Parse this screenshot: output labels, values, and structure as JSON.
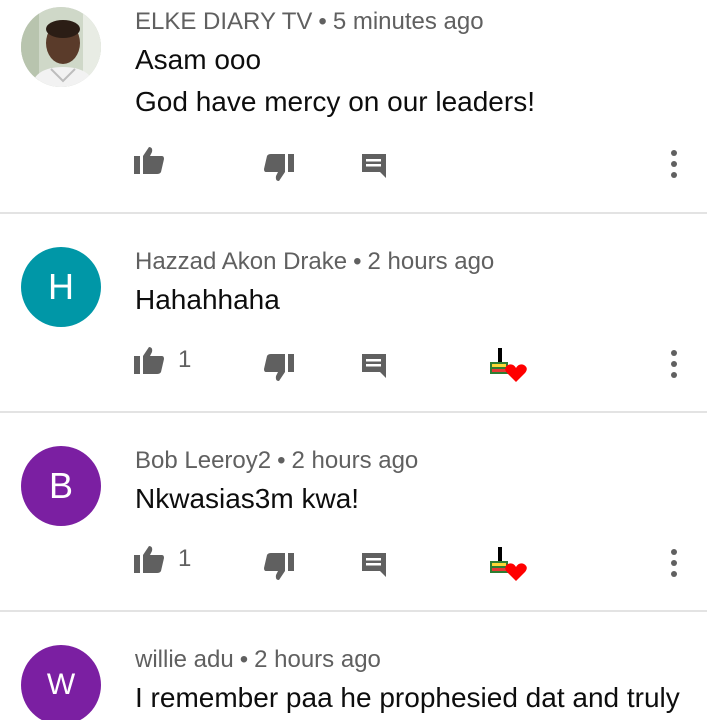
{
  "comments": [
    {
      "author": "ELKE DIARY TV",
      "time": "5 minutes ago",
      "avatar": {
        "type": "photo",
        "icon": "user-photo-avatar"
      },
      "lines": [
        "Asam ooo",
        "God have mercy on our leaders!"
      ],
      "likes": "",
      "creator_heart": false
    },
    {
      "author": "Hazzad Akon Drake",
      "time": "2 hours ago",
      "avatar": {
        "type": "letter",
        "letter": "H",
        "color": "#0097a7"
      },
      "lines": [
        "Hahahhaha"
      ],
      "likes": "1",
      "creator_heart": true
    },
    {
      "author": "Bob Leeroy2",
      "time": "2 hours ago",
      "avatar": {
        "type": "letter",
        "letter": "B",
        "color": "#7b1fa2"
      },
      "lines": [
        "Nkwasias3m kwa!"
      ],
      "likes": "1",
      "creator_heart": true
    },
    {
      "author": "willie adu",
      "time": "2 hours ago",
      "avatar": {
        "type": "letter",
        "letter": "W",
        "color": "#7b1fa2"
      },
      "lines": [
        "I remember paa he prophesied dat and truly"
      ],
      "likes": "",
      "creator_heart": false
    }
  ],
  "separator": "•",
  "colors": {
    "icon": "#606060",
    "meta_text": "#606060",
    "body_text": "#0d0d0d",
    "divider": "#e3e3e3",
    "heart": "#ff0000"
  },
  "icons": [
    "thumb-up-icon",
    "thumb-down-icon",
    "reply-icon",
    "more-vert-icon",
    "creator-heart-icon"
  ]
}
